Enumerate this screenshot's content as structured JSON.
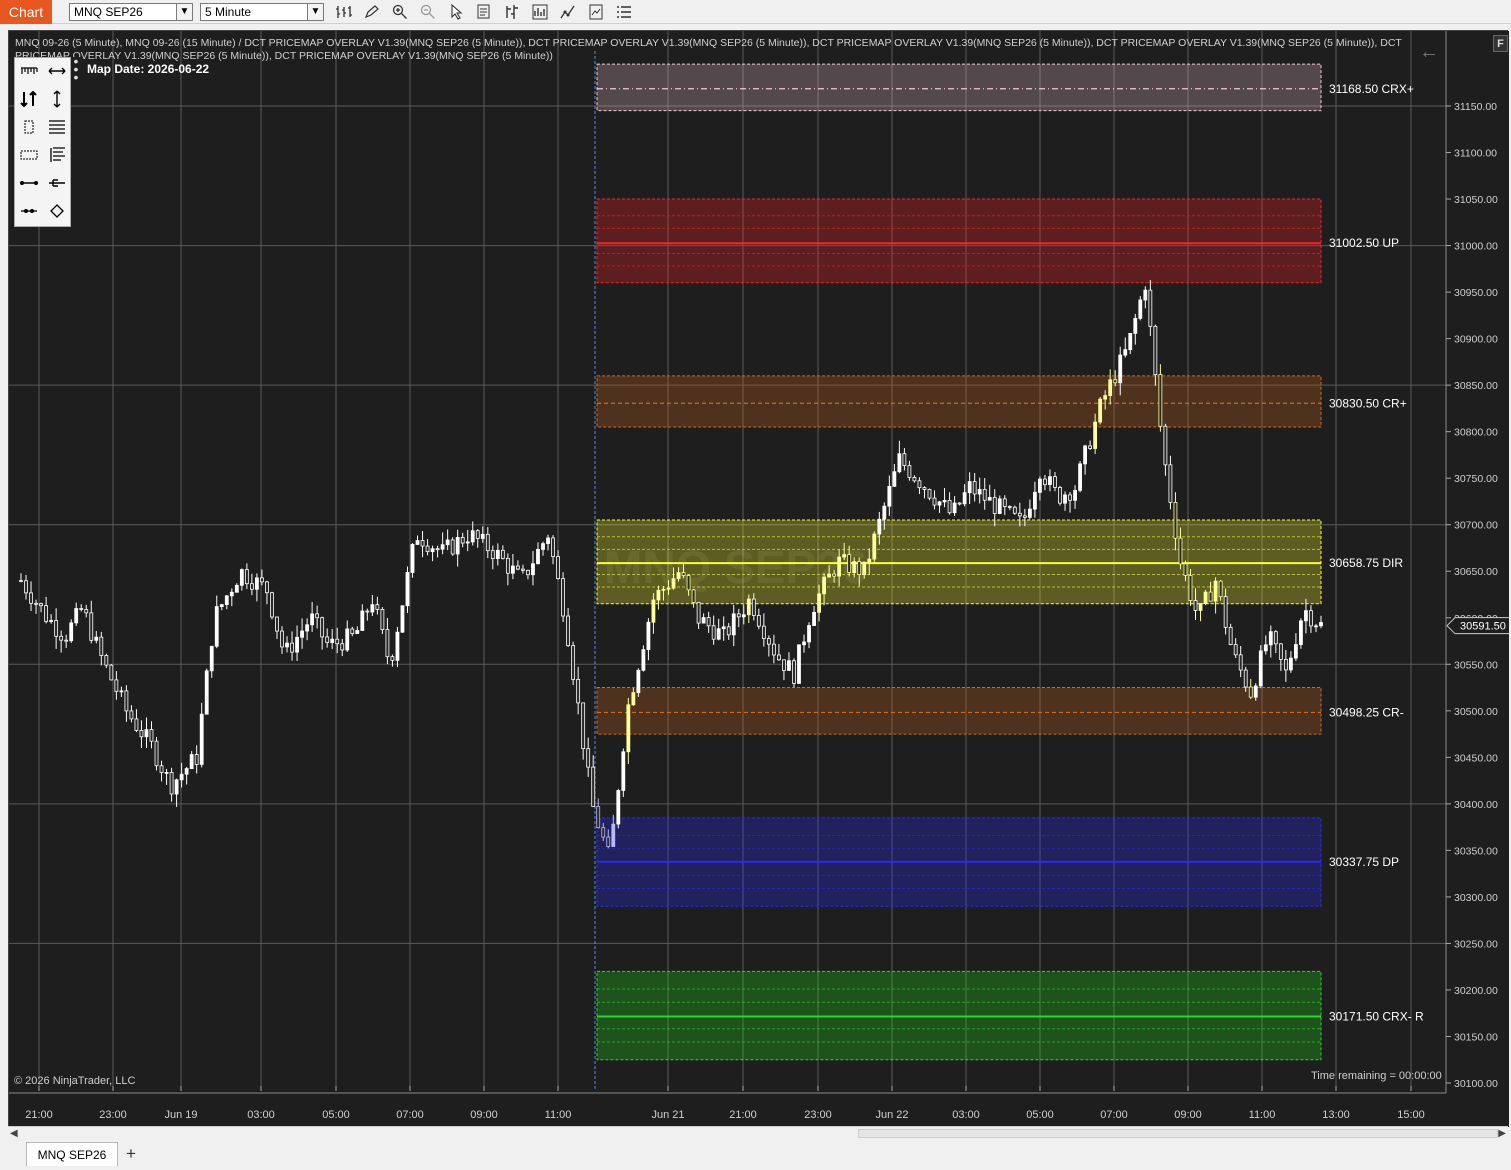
{
  "toolbar": {
    "chart_label": "Chart",
    "instrument": "MNQ SEP26",
    "interval": "5 Minute",
    "icons": [
      "bar-style-icon",
      "draw-pencil-icon",
      "zoom-in-icon",
      "zoom-out-icon",
      "pointer-icon",
      "data-box-icon",
      "chart-trader-icon",
      "indicators-icon",
      "strategies-icon",
      "templates-icon",
      "properties-icon"
    ]
  },
  "chart": {
    "header": "MNQ 09-26 (5 Minute), MNQ 09-26 (15 Minute) / DCT PRICEMAP OVERLAY V1.39(MNQ SEP26 (5 Minute)), DCT PRICEMAP OVERLAY V1.39(MNQ SEP26 (5 Minute)), DCT PRICEMAP OVERLAY V1.39(MNQ SEP26 (5 Minute)), DCT PRICEMAP OVERLAY V1.39(MNQ SEP26 (5 Minute)), DCT PRICEMAP OVERLAY V1.39(MNQ SEP26 (5 Minute)), DCT PRICEMAP OVERLAY V1.39(MNQ SEP26 (5 Minute))",
    "map_date": "Map Date: 2026-06-22",
    "copyright": "© 2026 NinjaTrader, LLC",
    "time_remaining": "Time remaining = 00:00:00",
    "watermark": "MNQ SEP26",
    "f_button": "F",
    "current_price": "30591.50",
    "current_price_value": 30591.5
  },
  "chart_data": {
    "type": "candlestick",
    "instrument": "MNQ SEP26",
    "ylim": [
      30090,
      31210
    ],
    "y_ticks": [
      30100,
      30150,
      30200,
      30250,
      30300,
      30350,
      30400,
      30450,
      30500,
      30550,
      30600,
      30650,
      30700,
      30750,
      30800,
      30850,
      30900,
      30950,
      31000,
      31050,
      31100,
      31150
    ],
    "y_tick_labels": [
      "30100.00",
      "30150.00",
      "30200.00",
      "30250.00",
      "30300.00",
      "30350.00",
      "30400.00",
      "30450.00",
      "30500.00",
      "30550.00",
      "30600.00",
      "30650.00",
      "30700.00",
      "30750.00",
      "30800.00",
      "30850.00",
      "30900.00",
      "30950.00",
      "31000.00",
      "31050.00",
      "31100.00",
      "31150.00"
    ],
    "x_ticks": [
      "21:00",
      "23:00",
      "Jun 19",
      "03:00",
      "05:00",
      "07:00",
      "09:00",
      "11:00",
      "Jun 21",
      "21:00",
      "23:00",
      "Jun 22",
      "03:00",
      "05:00",
      "07:00",
      "09:00",
      "11:00",
      "13:00",
      "15:00"
    ],
    "session_break_label": "Jun 21",
    "price_path": [
      [
        0,
        30640
      ],
      [
        3,
        30600
      ],
      [
        5,
        30580
      ],
      [
        7,
        30610
      ],
      [
        9,
        30560
      ],
      [
        12,
        30500
      ],
      [
        15,
        30460
      ],
      [
        17,
        30420
      ],
      [
        20,
        30450
      ],
      [
        22,
        30600
      ],
      [
        25,
        30650
      ],
      [
        28,
        30630
      ],
      [
        30,
        30560
      ],
      [
        33,
        30600
      ],
      [
        35,
        30570
      ],
      [
        38,
        30580
      ],
      [
        40,
        30620
      ],
      [
        42,
        30550
      ],
      [
        45,
        30690
      ],
      [
        48,
        30670
      ],
      [
        51,
        30690
      ],
      [
        54,
        30670
      ],
      [
        57,
        30640
      ],
      [
        60,
        30690
      ],
      [
        62,
        30600
      ],
      [
        65,
        30400
      ],
      [
        67,
        30340
      ],
      [
        69,
        30500
      ],
      [
        72,
        30620
      ],
      [
        75,
        30650
      ],
      [
        77,
        30600
      ],
      [
        80,
        30580
      ],
      [
        83,
        30620
      ],
      [
        86,
        30560
      ],
      [
        88,
        30540
      ],
      [
        90,
        30610
      ],
      [
        93,
        30660
      ],
      [
        96,
        30650
      ],
      [
        98,
        30710
      ],
      [
        100,
        30770
      ],
      [
        103,
        30740
      ],
      [
        106,
        30710
      ],
      [
        108,
        30740
      ],
      [
        111,
        30720
      ],
      [
        114,
        30700
      ],
      [
        116,
        30760
      ],
      [
        118,
        30730
      ],
      [
        120,
        30740
      ],
      [
        123,
        30830
      ],
      [
        126,
        30890
      ],
      [
        128,
        30960
      ],
      [
        130,
        30780
      ],
      [
        132,
        30660
      ],
      [
        134,
        30600
      ],
      [
        136,
        30640
      ],
      [
        138,
        30560
      ],
      [
        140,
        30520
      ],
      [
        142,
        30580
      ],
      [
        144,
        30540
      ],
      [
        146,
        30610
      ],
      [
        148,
        30591.5
      ]
    ],
    "levels": [
      {
        "price": 31168.5,
        "label": "31168.50 CRX+",
        "color": "#f2c9d6",
        "band_lo": 31145,
        "band_hi": 31195
      },
      {
        "price": 31002.5,
        "label": "31002.50 UP",
        "color": "#ff2020",
        "band_lo": 30960,
        "band_hi": 31050
      },
      {
        "price": 30830.5,
        "label": "30830.50 CR+",
        "color": "#d2691e",
        "band_lo": 30805,
        "band_hi": 30860
      },
      {
        "price": 30658.75,
        "label": "30658.75 DIR",
        "color": "#ffff33",
        "band_lo": 30615,
        "band_hi": 30705
      },
      {
        "price": 30498.25,
        "label": "30498.25 CR-",
        "color": "#d2691e",
        "band_lo": 30475,
        "band_hi": 30525
      },
      {
        "price": 30337.75,
        "label": "30337.75 DP",
        "color": "#2a2aff",
        "band_lo": 30290,
        "band_hi": 30385
      },
      {
        "price": 30171.5,
        "label": "30171.50 CRX- R",
        "color": "#22dd22",
        "band_lo": 30125,
        "band_hi": 30220
      }
    ]
  },
  "tool_palette": {
    "tools": [
      "ruler-icon",
      "horizontal-arrow-icon",
      "risk-reward-icon",
      "vertical-arrow-icon",
      "rectangle-icon",
      "horizontal-lines-icon",
      "region-icon",
      "fib-icon",
      "line-icon",
      "ray-icon",
      "extended-line-icon",
      "diamond-icon"
    ]
  },
  "tabs": {
    "instrument_tab": "MNQ SEP26",
    "add_tab": "+"
  },
  "scrollbar": {
    "left_arrow": "◀",
    "right_arrow": "▶"
  }
}
